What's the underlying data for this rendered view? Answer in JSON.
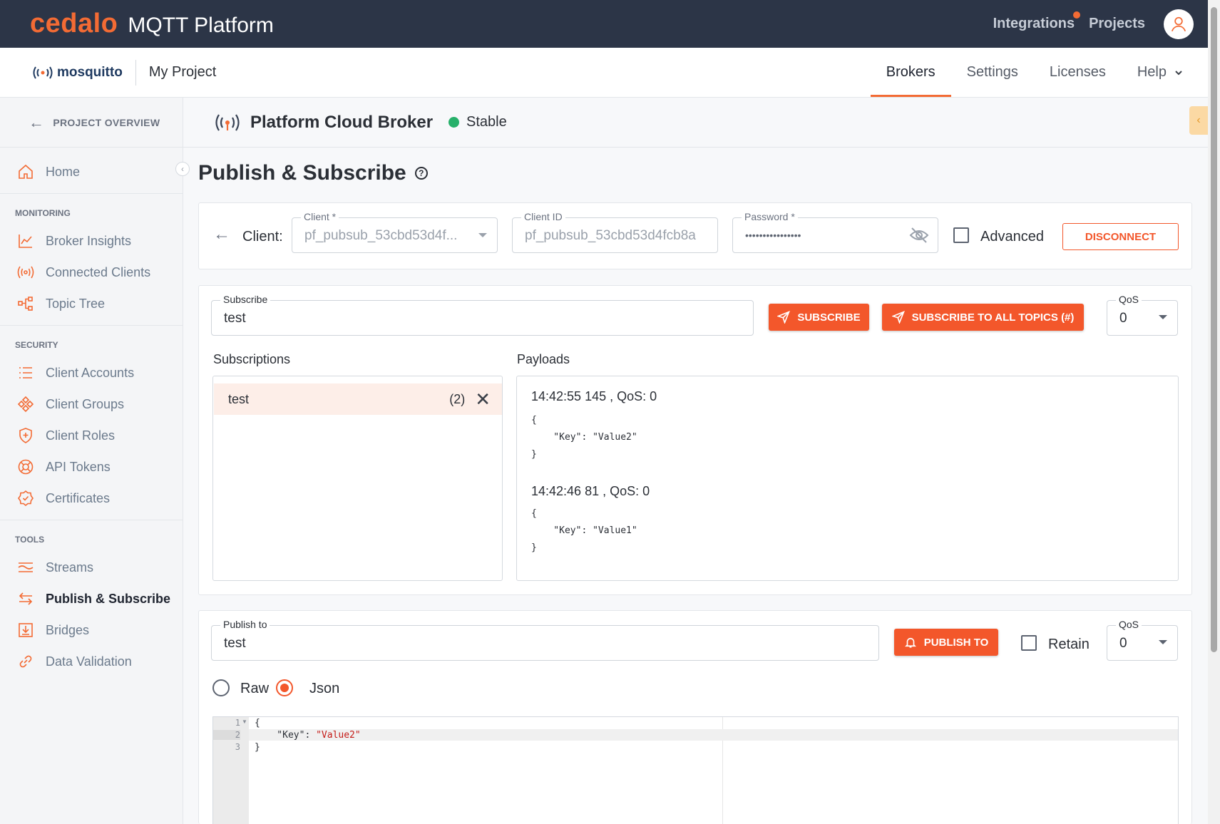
{
  "app": {
    "logo": "cedalo",
    "title": "MQTT Platform",
    "brand_color": "#f36b34"
  },
  "topnav": {
    "integrations": "Integrations",
    "projects": "Projects"
  },
  "subbar": {
    "logo_text": "mosquitto",
    "project": "My Project",
    "items": [
      "Brokers",
      "Settings",
      "Licenses",
      "Help"
    ],
    "active": "Brokers"
  },
  "sidebar": {
    "back": "PROJECT OVERVIEW",
    "home": "Home",
    "monitoring_label": "MONITORING",
    "monitoring": [
      "Broker Insights",
      "Connected Clients",
      "Topic Tree"
    ],
    "security_label": "SECURITY",
    "security": [
      "Client Accounts",
      "Client Groups",
      "Client Roles",
      "API Tokens",
      "Certificates"
    ],
    "tools_label": "TOOLS",
    "tools": [
      "Streams",
      "Publish & Subscribe",
      "Bridges",
      "Data Validation"
    ],
    "active": "Publish & Subscribe"
  },
  "broker": {
    "name": "Platform Cloud Broker",
    "status": "Stable",
    "status_color": "#27b06a"
  },
  "page": {
    "title": "Publish & Subscribe"
  },
  "client": {
    "label": "Client:",
    "client_label": "Client *",
    "client_value": "pf_pubsub_53cbd53d4f...",
    "client_id_label": "Client ID",
    "client_id_value": "pf_pubsub_53cbd53d4fcb8a",
    "password_label": "Password *",
    "password_value": "••••••••••••••••",
    "advanced": "Advanced",
    "disconnect": "DISCONNECT"
  },
  "subscribe": {
    "label": "Subscribe",
    "value": "test",
    "button": "SUBSCRIBE",
    "button_all": "SUBSCRIBE TO ALL TOPICS (#)",
    "qos_label": "QoS",
    "qos_value": "0",
    "subscriptions_label": "Subscriptions",
    "payloads_label": "Payloads",
    "subscriptions": [
      {
        "topic": "test",
        "count": "(2)"
      }
    ],
    "payloads": [
      {
        "header": "14:42:55 145 , QoS: 0",
        "body": "{\n    \"Key\": \"Value2\"\n}"
      },
      {
        "header": "14:42:46 81 , QoS: 0",
        "body": "{\n    \"Key\": \"Value1\"\n}"
      }
    ]
  },
  "publish": {
    "label": "Publish to",
    "value": "test",
    "button": "PUBLISH TO",
    "retain": "Retain",
    "qos_label": "QoS",
    "qos_value": "0",
    "format_raw": "Raw",
    "format_json": "Json",
    "editor_lines": [
      "1",
      "2",
      "3"
    ],
    "code_open": "{",
    "code_key": "    \"Key\": ",
    "code_value": "\"Value2\"",
    "code_close": "}"
  }
}
